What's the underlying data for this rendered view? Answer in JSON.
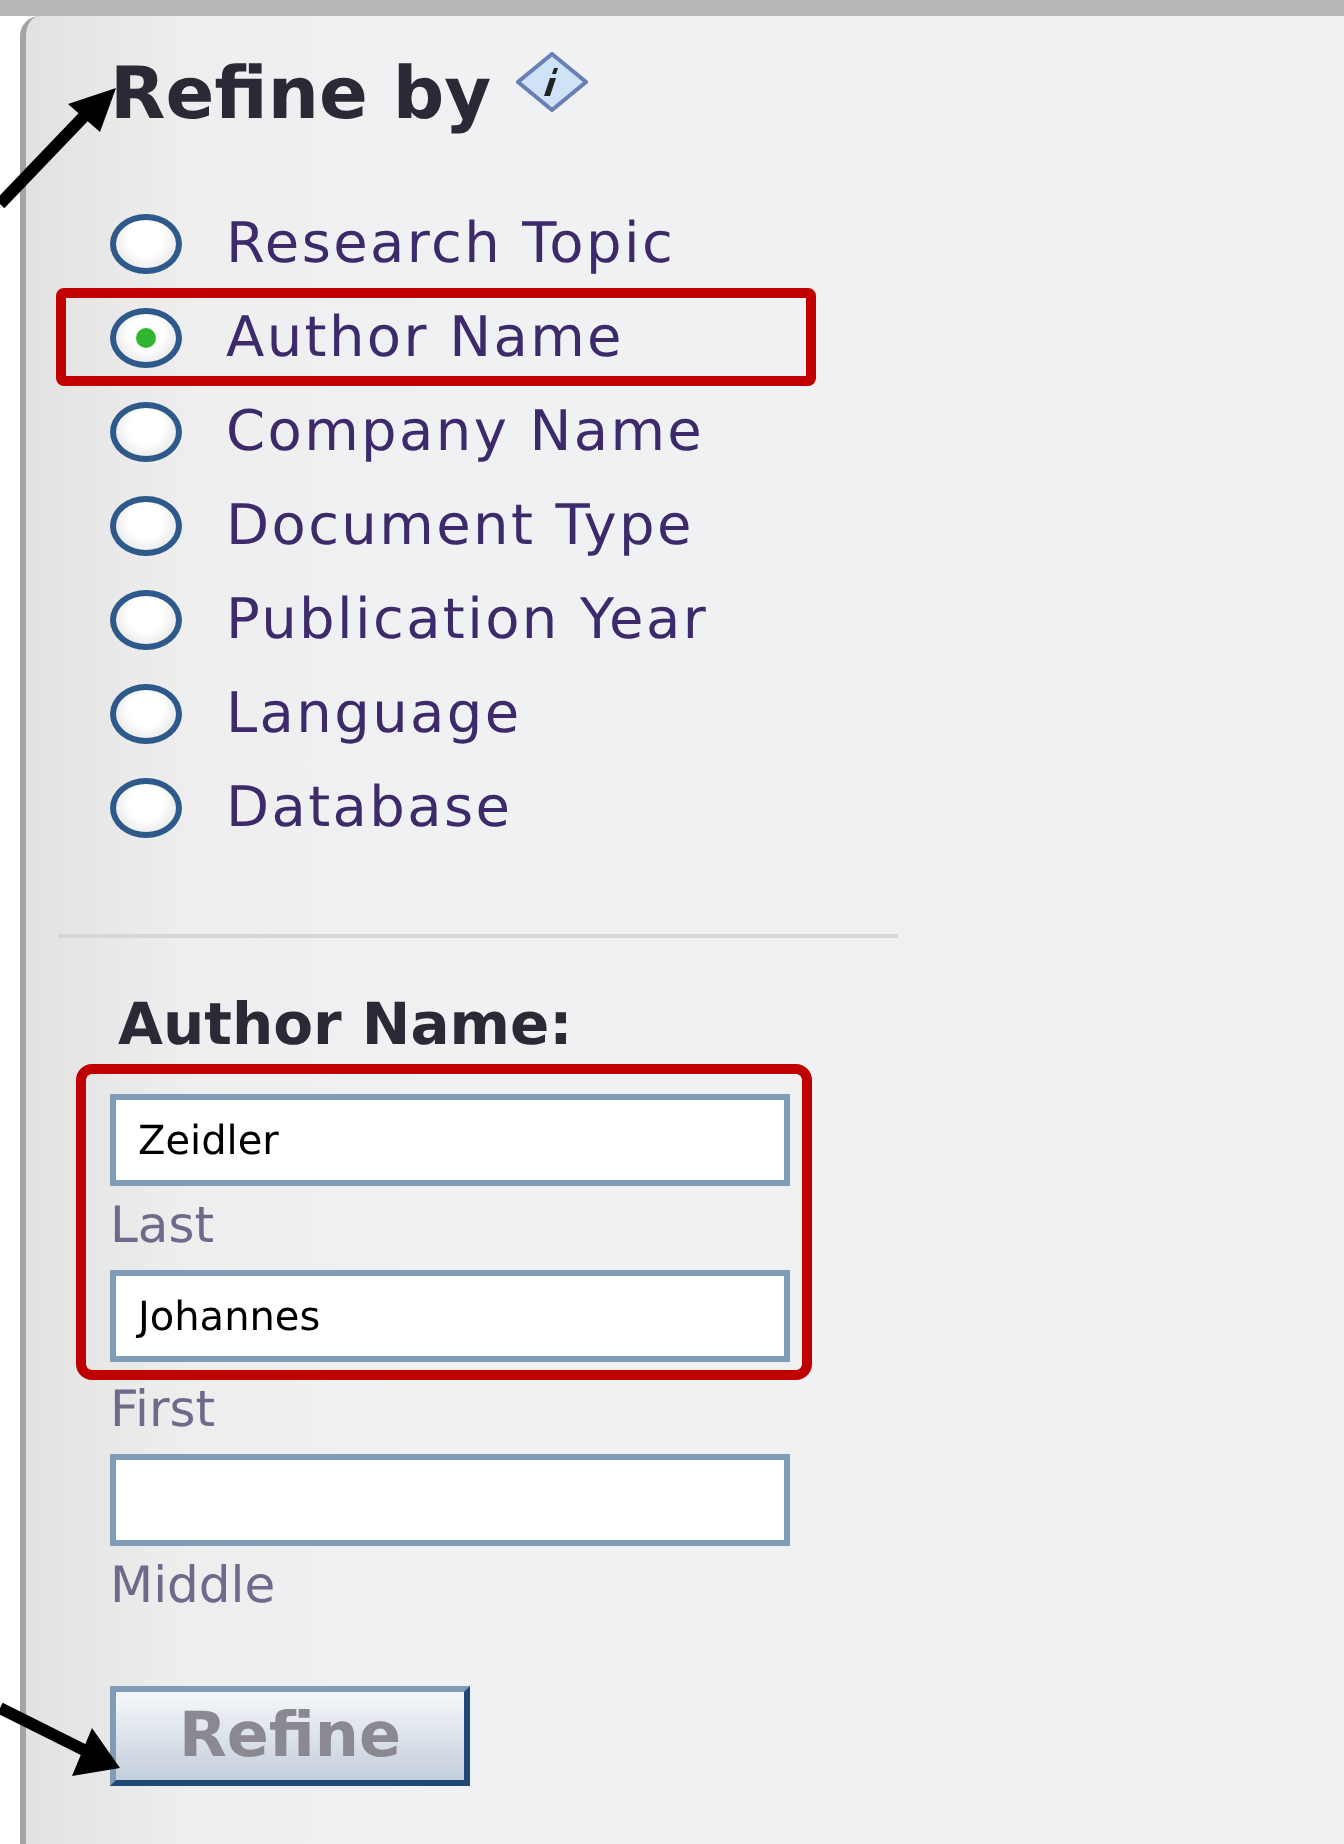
{
  "panel": {
    "title": "Refine by",
    "options": [
      {
        "label": "Research Topic",
        "selected": false,
        "highlighted": false
      },
      {
        "label": "Author Name",
        "selected": true,
        "highlighted": true
      },
      {
        "label": "Company Name",
        "selected": false,
        "highlighted": false
      },
      {
        "label": "Document Type",
        "selected": false,
        "highlighted": false
      },
      {
        "label": "Publication Year",
        "selected": false,
        "highlighted": false
      },
      {
        "label": "Language",
        "selected": false,
        "highlighted": false
      },
      {
        "label": "Database",
        "selected": false,
        "highlighted": false
      }
    ],
    "section_title": "Author Name:",
    "fields": [
      {
        "value": "Zeidler",
        "caption": "Last",
        "highlighted": true
      },
      {
        "value": "Johannes",
        "caption": "First",
        "highlighted": true
      },
      {
        "caption": "Middle",
        "highlighted": false
      }
    ],
    "button": "Refine"
  }
}
